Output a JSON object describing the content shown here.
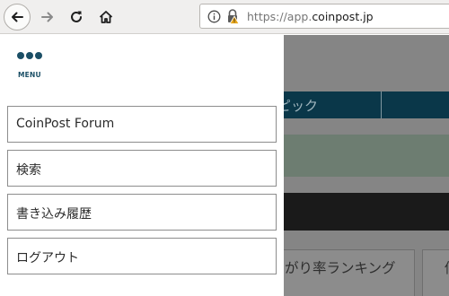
{
  "browser": {
    "url_prefix": "https://app.",
    "url_domain": "coinpost.jp",
    "colors": {
      "toolbar_bg": "#f0efee",
      "warning_lock": "#e8a61a"
    }
  },
  "drawer": {
    "menu_label": "MENU",
    "items": [
      {
        "label": "CoinPost Forum"
      },
      {
        "label": "検索"
      },
      {
        "label": "書き込み履歴"
      },
      {
        "label": "ログアウト"
      }
    ],
    "colors": {
      "accent": "#1b4f66"
    }
  },
  "background_page": {
    "nav_label": "ピック",
    "tabs": [
      {
        "label": "がり率ランキング"
      },
      {
        "label": "価"
      }
    ]
  }
}
